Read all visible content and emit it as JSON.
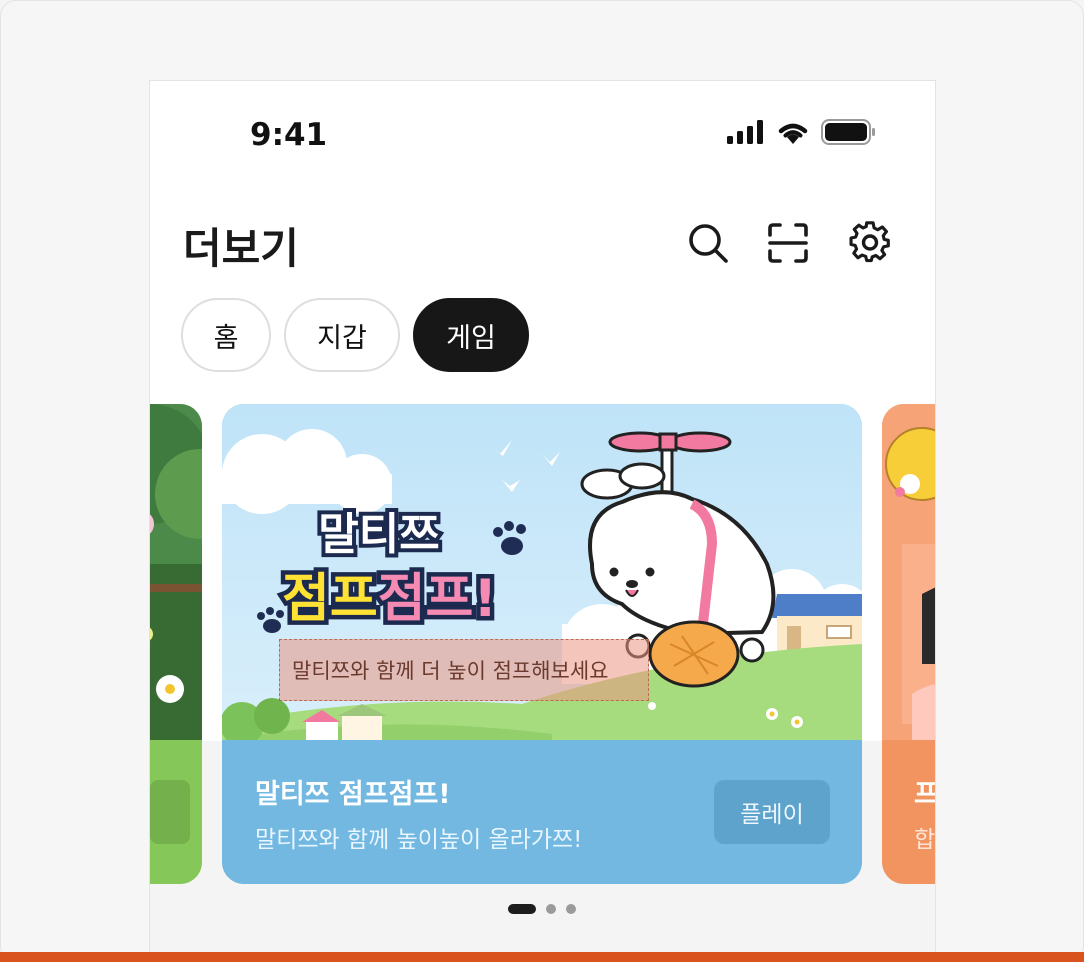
{
  "status_bar": {
    "time": "9:41"
  },
  "header": {
    "title": "더보기"
  },
  "header_icons": [
    "search-icon",
    "scan-icon",
    "gear-icon"
  ],
  "tabs": [
    {
      "label": "홈",
      "active": false
    },
    {
      "label": "지갑",
      "active": false
    },
    {
      "label": "게임",
      "active": true
    }
  ],
  "carousel": {
    "cards": [
      {
        "banner_title_line1": "말티쯔",
        "banner_title_line2a": "점프",
        "banner_title_line2b": "점프!",
        "banner_caption": "말티쯔와 함께 더 높이 점프해보세요",
        "title": "말티쯔 점프점프!",
        "description": "말티쯔와 함께 높이높이 올라가쯔!",
        "button_label": "플레이"
      }
    ],
    "right_card_peek": {
      "title_fragment": "프",
      "desc_fragment": "합"
    },
    "page_count": 3,
    "active_index": 0
  },
  "colors": {
    "accent_stripe": "#d9531e",
    "card_main": "#72b8e1",
    "card_left": "#8ecb5a",
    "card_right": "#f2945f",
    "tab_active": "#171717"
  }
}
